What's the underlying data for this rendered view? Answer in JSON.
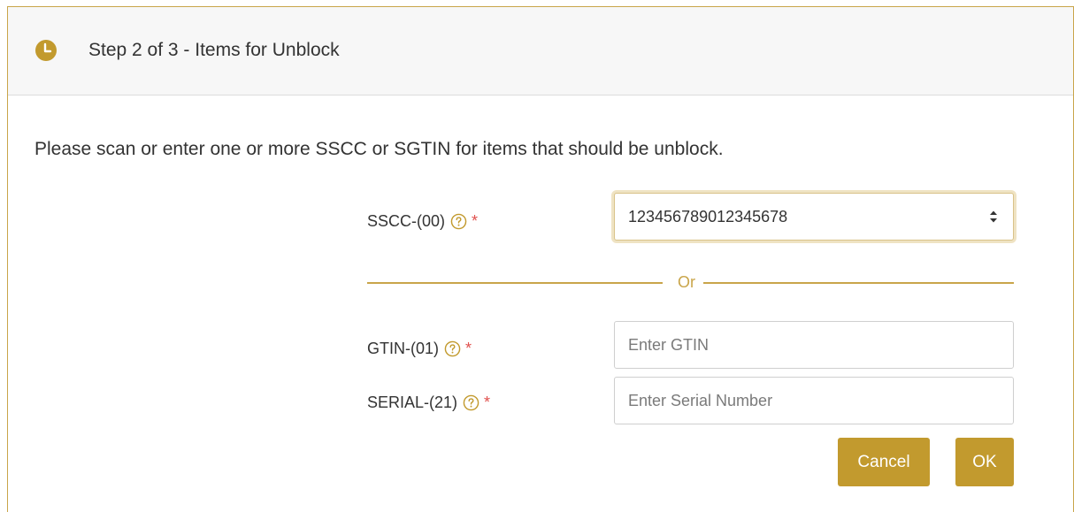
{
  "header": {
    "title": "Step 2 of 3 - Items for Unblock"
  },
  "instructions": "Please scan or enter one or more SSCC or SGTIN for items that should be unblock.",
  "fields": {
    "sscc": {
      "label": "SSCC-(00)",
      "required_mark": "*",
      "value": "123456789012345678"
    },
    "separator": "Or",
    "gtin": {
      "label": "GTIN-(01)",
      "required_mark": "*",
      "placeholder": "Enter GTIN"
    },
    "serial": {
      "label": "SERIAL-(21)",
      "required_mark": "*",
      "placeholder": "Enter Serial Number"
    }
  },
  "buttons": {
    "cancel": "Cancel",
    "ok": "OK"
  },
  "colors": {
    "accent": "#c29a2e",
    "required": "#e0504d",
    "divider": "#c9a54a"
  },
  "icons": {
    "step": "clock-icon",
    "help": "question-circle-icon",
    "spinner": "number-spinner-icon"
  }
}
